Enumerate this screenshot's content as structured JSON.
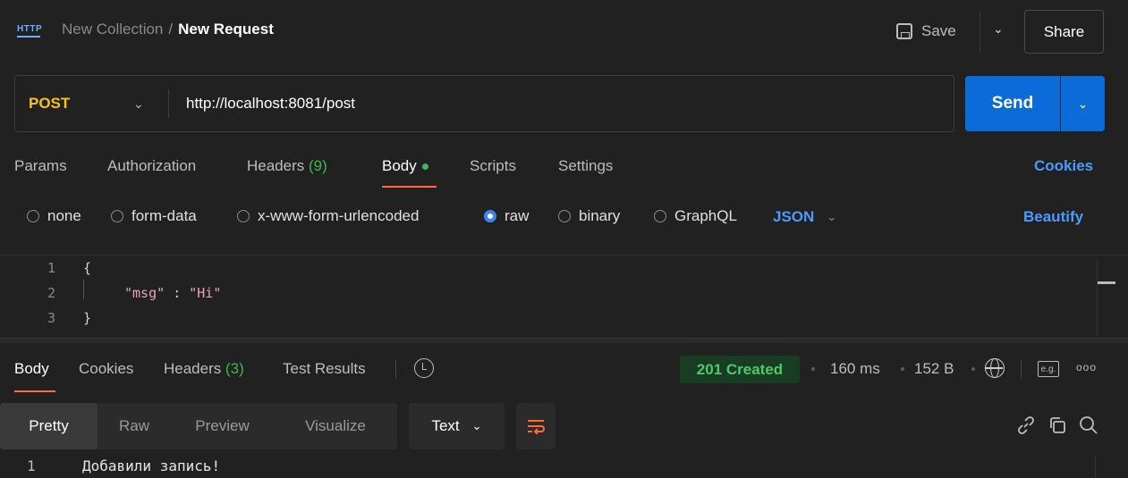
{
  "titlebar": {
    "icon_label": "HTTP",
    "collection": "New Collection",
    "separator": "/",
    "request_name": "New Request",
    "save_label": "Save",
    "share_label": "Share"
  },
  "request": {
    "method": "POST",
    "url": "http://localhost:8081/post",
    "send_label": "Send"
  },
  "request_tabs": {
    "params": "Params",
    "authorization": "Authorization",
    "headers_label": "Headers",
    "headers_count": "(9)",
    "body": "Body",
    "scripts": "Scripts",
    "settings": "Settings",
    "cookies": "Cookies",
    "active": "Body"
  },
  "body_types": {
    "none": "none",
    "form_data": "form-data",
    "urlencoded": "x-www-form-urlencoded",
    "raw": "raw",
    "binary": "binary",
    "graphql": "GraphQL",
    "selected": "raw",
    "format": "JSON",
    "beautify": "Beautify"
  },
  "editor": {
    "line_numbers": [
      "1",
      "2",
      "3"
    ],
    "open_brace": "{",
    "key": "\"msg\"",
    "colon": ":",
    "value": "\"Hi\"",
    "close_brace": "}"
  },
  "response_tabs": {
    "body": "Body",
    "cookies": "Cookies",
    "headers_label": "Headers",
    "headers_count": "(3)",
    "test_results": "Test Results",
    "active": "Body"
  },
  "response_meta": {
    "status": "201 Created",
    "time": "160 ms",
    "size": "152 B",
    "status_color": "#4ec969"
  },
  "response_toolbar": {
    "pretty": "Pretty",
    "raw": "Raw",
    "preview": "Preview",
    "visualize": "Visualize",
    "format": "Text",
    "active": "Pretty"
  },
  "response_body": {
    "line_number": "1",
    "text": "Добавили запись!"
  },
  "icons": {
    "eg_label": "e.g.",
    "more": "ooo"
  }
}
